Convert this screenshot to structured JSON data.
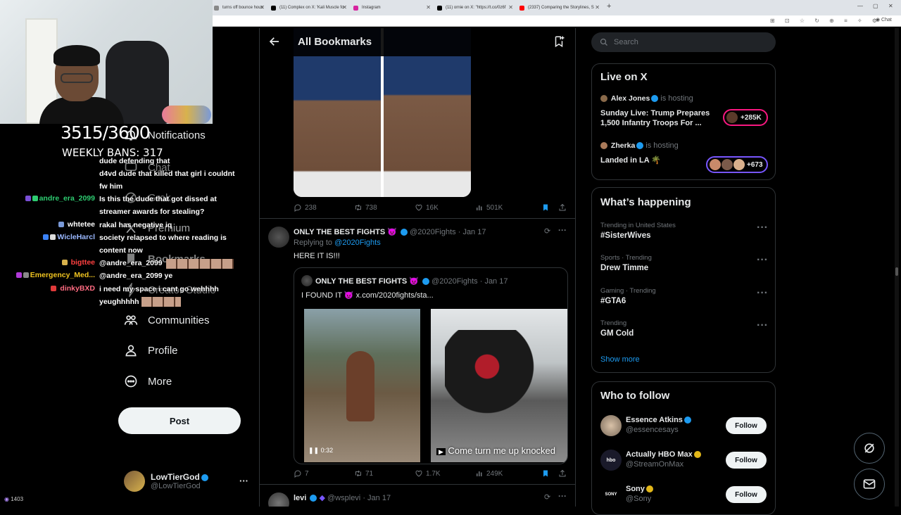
{
  "browser": {
    "tabs": [
      {
        "label": "turns off bounce hous",
        "color": "#555"
      },
      {
        "label": "(11) Complex on X: 'Kali Muscle fo",
        "color": "#000"
      },
      {
        "label": "Instagram",
        "color": "#d6249f"
      },
      {
        "label": "(11) ornie on X: \"https://t.co/0z6f",
        "color": "#000"
      },
      {
        "label": "(2337) Comparing the Storylines, S",
        "color": "#ff0000"
      }
    ]
  },
  "stream": {
    "stat_line1": "3515/3600",
    "stat_line2": "WEEKLY BANS: 317",
    "viewer_count": "1403"
  },
  "chat": {
    "messages": [
      {
        "user": "",
        "text": "dude defending that"
      },
      {
        "user": "",
        "text": "d4vd dude that killed that girl i couldnt"
      },
      {
        "user": "",
        "text": "fw him"
      },
      {
        "user": "andre_era_2099",
        "text": "Is this the dude that got dissed at"
      },
      {
        "user": "",
        "text": "streamer awards for stealing?"
      },
      {
        "user": "whtetee",
        "text": "rakal has negative iq"
      },
      {
        "user": "WicleHarcl",
        "text": "society relapsed to where reading is"
      },
      {
        "user": "",
        "text": "content now"
      },
      {
        "user": "bigttee",
        "text": "@andre_era_2099"
      },
      {
        "user": "Emergency_Med...",
        "text": "@andre_era_2099 ye"
      },
      {
        "user": "dinkyBXD",
        "text": "i need my space i cant go wehhhh"
      },
      {
        "user": "",
        "text": "yeughhhhh"
      }
    ],
    "user_colors": {
      "andre_era_2099": "#2ecc71",
      "whtetee": "#ffffff",
      "WicleHarcl": "#9ab8ff",
      "bigttee": "#ff4040",
      "Emergency_Med...": "#f0c420",
      "dinkyBXD": "#ff6b81"
    }
  },
  "nav": {
    "items": [
      {
        "label": "Notifications",
        "icon": "bell-icon"
      },
      {
        "label": "Chat",
        "icon": "chat-icon"
      },
      {
        "label": "Grok",
        "icon": "grok-icon"
      },
      {
        "label": "Premium",
        "icon": "x-icon"
      },
      {
        "label": "Bookmarks",
        "icon": "bookmark-icon"
      },
      {
        "label": "Creator Studio",
        "icon": "lightning-icon"
      },
      {
        "label": "Communities",
        "icon": "communities-icon"
      },
      {
        "label": "Profile",
        "icon": "profile-icon"
      },
      {
        "label": "More",
        "icon": "more-circle-icon"
      }
    ],
    "post_label": "Post",
    "account": {
      "name": "LowTierGod",
      "handle": "@LowTierGod"
    }
  },
  "main": {
    "title": "All Bookmarks",
    "tweet1": {
      "replies": "238",
      "retweets": "738",
      "likes": "16K",
      "views": "501K"
    },
    "tweet2": {
      "author": "ONLY THE BEST FIGHTS 😈",
      "handle": "@2020Fights",
      "date": "· Jan 17",
      "replying_prefix": "Replying to",
      "replying_to": "@2020Fights",
      "text": "HERE IT IS!!!",
      "quote": {
        "author": "ONLY THE BEST FIGHTS 😈",
        "handle": "@2020Fights",
        "date": "· Jan 17",
        "text": "I FOUND IT 😈 x.com/2020fights/sta..."
      },
      "video_time": "0:32",
      "video2_caption": "Come turn me up knocked",
      "replies": "7",
      "retweets": "71",
      "likes": "1.7K",
      "views": "249K"
    },
    "tweet3": {
      "author": "levi",
      "handle": "@wsplevi",
      "date": "· Jan 17"
    }
  },
  "sidebar": {
    "search_placeholder": "Search",
    "live": {
      "title": "Live on X",
      "items": [
        {
          "host": "Alex Jones",
          "hosting": "is hosting",
          "title_line1": "Sunday Live: Trump Prepares",
          "title_line2": "1,500 Infantry Troops For ...",
          "count": "+285K",
          "accent": "#f91880"
        },
        {
          "host": "Zherka",
          "hosting": "is hosting",
          "title_line1": "Landed in LA 🌴",
          "title_line2": "",
          "count": "+673",
          "accent": "#7856ff"
        }
      ]
    },
    "happening": {
      "title": "What’s happening",
      "trends": [
        {
          "category": "Trending in United States",
          "name": "#SisterWives"
        },
        {
          "category": "Sports · Trending",
          "name": "Drew Timme"
        },
        {
          "category": "Gaming · Trending",
          "name": "#GTA6"
        },
        {
          "category": "Trending",
          "name": "GM Cold"
        }
      ],
      "show_more": "Show more"
    },
    "who_to_follow": {
      "title": "Who to follow",
      "follow_label": "Follow",
      "accounts": [
        {
          "name": "Essence Atkins",
          "handle": "@essencesays",
          "badge": "blue"
        },
        {
          "name": "Actually HBO Max",
          "handle": "@StreamOnMax",
          "badge": "gold"
        },
        {
          "name": "Sony",
          "handle": "@Sony",
          "badge": "gold"
        }
      ]
    }
  },
  "colors": {
    "accent": "#1d9bf0",
    "bg": "#000000",
    "border": "#2f3336",
    "muted": "#71767b"
  }
}
